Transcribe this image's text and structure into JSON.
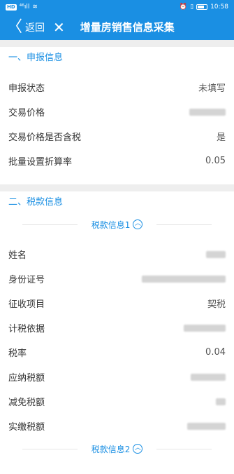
{
  "status_bar": {
    "left_badge": "HD",
    "signal": "⁴⁶ıll",
    "wifi": "≋",
    "icons_right": "⏰ ▯◻",
    "time": "10:58"
  },
  "nav": {
    "back_label": "返回",
    "close_glyph": "✕",
    "title": "增量房销售信息采集"
  },
  "section_declare": {
    "title": "一、申报信息",
    "rows": [
      {
        "label": "申报状态",
        "value": "未填写"
      },
      {
        "label": "交易价格",
        "value": ""
      },
      {
        "label": "交易价格是否含税",
        "value": "是"
      },
      {
        "label": "批量设置折算率",
        "value": "0.05"
      }
    ]
  },
  "section_tax": {
    "title": "二、税款信息",
    "group1_title": "税款信息1",
    "rows": [
      {
        "label": "姓名",
        "value": ""
      },
      {
        "label": "身份证号",
        "value": ""
      },
      {
        "label": "征收项目",
        "value": "契税"
      },
      {
        "label": "计税依据",
        "value": ""
      },
      {
        "label": "税率",
        "value": "0.04"
      },
      {
        "label": "应纳税额",
        "value": ""
      },
      {
        "label": "减免税额",
        "value": ""
      },
      {
        "label": "实缴税额",
        "value": ""
      }
    ],
    "group2_title": "税款信息2"
  },
  "colors": {
    "accent": "#1a8fe3",
    "divider": "#eeeeee"
  }
}
